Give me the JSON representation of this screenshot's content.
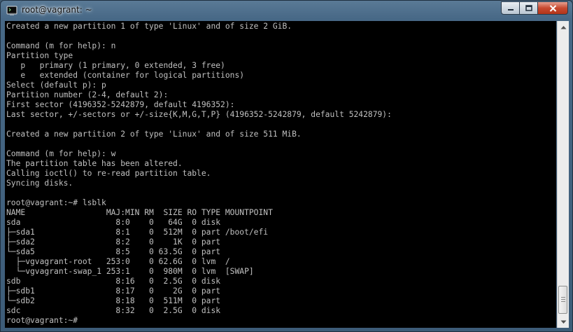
{
  "window": {
    "title": "root@vagrant: ~"
  },
  "terminal": {
    "lines": [
      "Created a new partition 1 of type 'Linux' and of size 2 GiB.",
      "",
      "Command (m for help): n",
      "Partition type",
      "   p   primary (1 primary, 0 extended, 3 free)",
      "   e   extended (container for logical partitions)",
      "Select (default p): p",
      "Partition number (2-4, default 2):",
      "First sector (4196352-5242879, default 4196352):",
      "Last sector, +/-sectors or +/-size{K,M,G,T,P} (4196352-5242879, default 5242879):",
      "",
      "Created a new partition 2 of type 'Linux' and of size 511 MiB.",
      "",
      "Command (m for help): w",
      "The partition table has been altered.",
      "Calling ioctl() to re-read partition table.",
      "Syncing disks.",
      "",
      "root@vagrant:~# lsblk",
      "NAME                 MAJ:MIN RM  SIZE RO TYPE MOUNTPOINT",
      "sda                    8:0    0   64G  0 disk",
      "├─sda1                 8:1    0  512M  0 part /boot/efi",
      "├─sda2                 8:2    0    1K  0 part",
      "└─sda5                 8:5    0 63.5G  0 part",
      "  ├─vgvagrant-root   253:0    0 62.6G  0 lvm  /",
      "  └─vgvagrant-swap_1 253:1    0  980M  0 lvm  [SWAP]",
      "sdb                    8:16   0  2.5G  0 disk",
      "├─sdb1                 8:17   0    2G  0 part",
      "└─sdb2                 8:18   0  511M  0 part",
      "sdc                    8:32   0  2.5G  0 disk",
      "root@vagrant:~#"
    ]
  },
  "icons": {
    "app": "terminal-app-icon",
    "minimize": "minimize-icon",
    "maximize": "maximize-icon",
    "close": "close-icon",
    "scroll_up": "arrow-up-icon",
    "scroll_down": "arrow-down-icon"
  },
  "colors": {
    "background": "#000000",
    "text": "#c0c0c0",
    "close": "#c7492f"
  }
}
